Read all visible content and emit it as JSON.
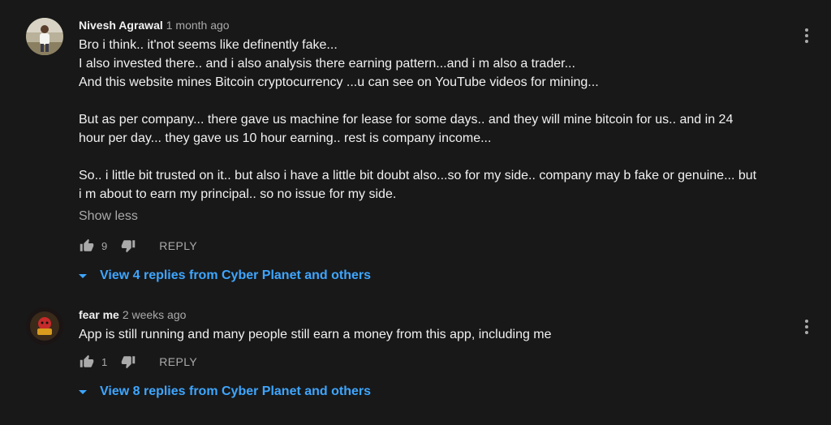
{
  "comments": [
    {
      "author": "Nivesh Agrawal",
      "timestamp": "1 month ago",
      "text_lines": [
        "Bro i think.. it'not seems like definently fake...",
        "I also invested there.. and i also analysis there earning pattern...and i m also a trader...",
        "And this website mines Bitcoin cryptocurrency ...u can see on YouTube videos for mining...",
        "",
        "But as per company... there gave us machine for lease for some days.. and they will mine bitcoin for us.. and in 24",
        "hour per day... they gave us 10 hour earning.. rest is company income...",
        "",
        "So.. i little bit trusted on it.. but also i have a little bit doubt also...so for my side.. company may b fake or genuine... but",
        "i m about to earn my principal.. so no issue for my side."
      ],
      "show_less_label": "Show less",
      "like_count": "9",
      "reply_label": "REPLY",
      "view_replies_label": "View 4 replies from Cyber Planet and others",
      "icons": {
        "like": "thumbs-up-icon",
        "dislike": "thumbs-down-icon",
        "menu": "more-vert-icon",
        "expand": "caret-down-icon"
      }
    },
    {
      "author": "fear me",
      "timestamp": "2 weeks ago",
      "text_lines": [
        "App is still running and many people still earn a money from this app, including me"
      ],
      "like_count": "1",
      "reply_label": "REPLY",
      "view_replies_label": "View 8 replies from Cyber Planet and others",
      "icons": {
        "like": "thumbs-up-icon",
        "dislike": "thumbs-down-icon",
        "menu": "more-vert-icon",
        "expand": "caret-down-icon"
      }
    }
  ],
  "colors": {
    "background": "#181818",
    "text": "#f1f1f1",
    "secondary_text": "#aaaaaa",
    "link": "#3ea6ff"
  }
}
